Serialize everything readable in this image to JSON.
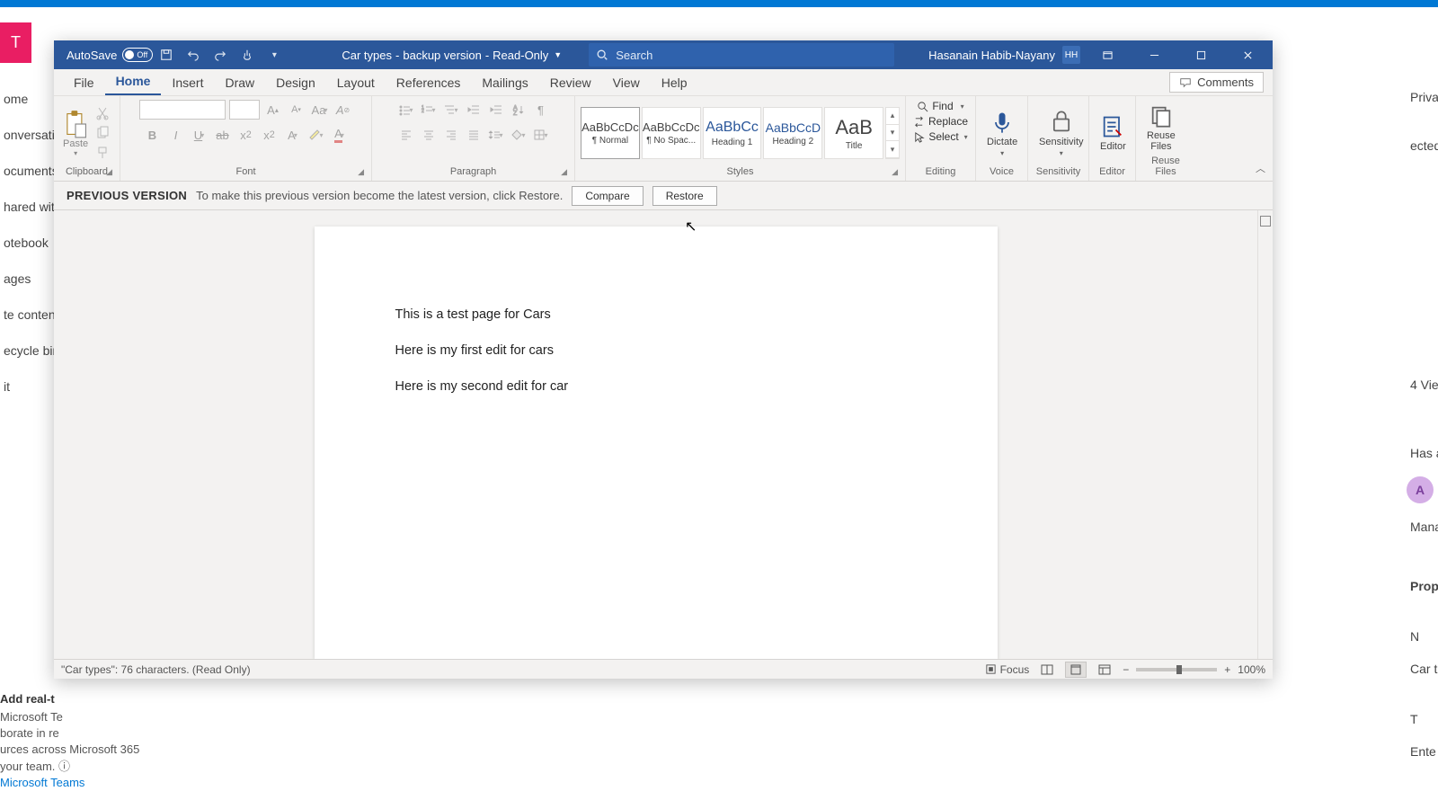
{
  "bg": {
    "tile": "T",
    "nav": [
      "ome",
      "onversatio",
      "ocuments",
      "hared with",
      "otebook",
      "ages",
      "te content",
      "ecycle bin",
      "it"
    ],
    "bottom_title": "Add real-t",
    "bottom_lines": [
      "Microsoft Te",
      "borate in re",
      "urces across Microsoft 365",
      "your team. ⓘ",
      "Microsoft Teams"
    ],
    "right": {
      "private": "Private",
      "ected": "ected",
      "views": "4 Vie",
      "has": "Has a",
      "mana": "Mana",
      "prop": "Prop",
      "n": "N",
      "car": "Car t",
      "t": "T",
      "ente": "Ente"
    }
  },
  "titlebar": {
    "autosave_label": "AutoSave",
    "autosave_state": "Off",
    "doc_name": "Car types",
    "sep1": "-",
    "suffix": "backup version",
    "sep2": "-",
    "mode": "Read-Only",
    "search_placeholder": "Search",
    "user_name": "Hasanain Habib-Nayany",
    "user_initials": "HH"
  },
  "menu": {
    "file": "File",
    "home": "Home",
    "insert": "Insert",
    "draw": "Draw",
    "design": "Design",
    "layout": "Layout",
    "references": "References",
    "mailings": "Mailings",
    "review": "Review",
    "view": "View",
    "help": "Help",
    "comments": "Comments"
  },
  "ribbon": {
    "clipboard": {
      "label": "Clipboard",
      "paste": "Paste"
    },
    "font": {
      "label": "Font"
    },
    "paragraph": {
      "label": "Paragraph"
    },
    "styles": {
      "label": "Styles",
      "items": [
        {
          "preview": "AaBbCcDc",
          "name": "¶ Normal",
          "size": "13px",
          "color": "#444"
        },
        {
          "preview": "AaBbCcDc",
          "name": "¶ No Spac...",
          "size": "13px",
          "color": "#444"
        },
        {
          "preview": "AaBbCc",
          "name": "Heading 1",
          "size": "16px",
          "color": "#2b579a"
        },
        {
          "preview": "AaBbCcD",
          "name": "Heading 2",
          "size": "14px",
          "color": "#2b579a"
        },
        {
          "preview": "AaB",
          "name": "Title",
          "size": "22px",
          "color": "#333"
        }
      ]
    },
    "editing": {
      "label": "Editing",
      "find": "Find",
      "replace": "Replace",
      "select": "Select"
    },
    "voice": {
      "label": "Voice",
      "dictate": "Dictate"
    },
    "sensitivity": {
      "label": "Sensitivity",
      "btn": "Sensitivity"
    },
    "editor": {
      "label": "Editor",
      "btn": "Editor"
    },
    "reuse": {
      "label": "Reuse Files",
      "btn": "Reuse\nFiles"
    }
  },
  "msgbar": {
    "title": "PREVIOUS VERSION",
    "text": "To make this previous version become the latest version, click Restore.",
    "compare": "Compare",
    "restore": "Restore"
  },
  "document": {
    "p1": "This is a test page for Cars",
    "p2": "Here is my first edit for cars",
    "p3": "Here is my second edit for car"
  },
  "statusbar": {
    "left": "\"Car types\": 76 characters.  (Read Only)",
    "focus": "Focus",
    "zoom": "100%"
  }
}
